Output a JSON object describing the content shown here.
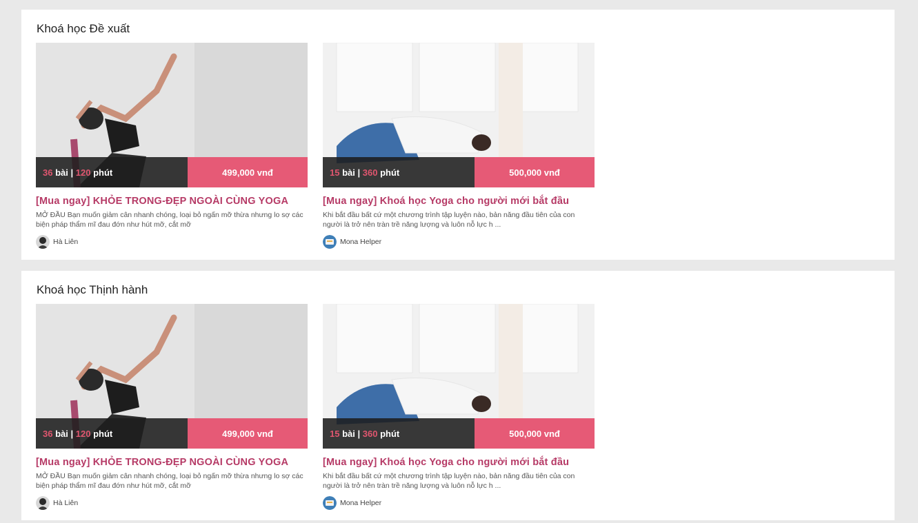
{
  "sections": [
    {
      "title": "Khoá học Đề xuất",
      "courses": [
        {
          "lessons": "36",
          "lessons_unit": "bài",
          "separator": "|",
          "minutes": "120",
          "minutes_unit": "phút",
          "price": "499,000 vnđ",
          "title": "[Mua ngay] KHỎE TRONG-ĐẸP NGOÀI CÙNG YOGA",
          "description": "MỞ ĐẦU Bạn muốn giảm cân nhanh chóng, loại bỏ ngấn mỡ thừa nhưng lo sợ các biện pháp thẩm mĩ đau đớn như hút mỡ, cắt mỡ",
          "author": "Hà Liên"
        },
        {
          "lessons": "15",
          "lessons_unit": "bài",
          "separator": "|",
          "minutes": "360",
          "minutes_unit": "phút",
          "price": "500,000 vnđ",
          "title": "[Mua ngay] Khoá học Yoga cho người mới bắt đầu",
          "description": "Khi bắt đầu bất cứ một chương trình tập luyện nào, bản năng đầu tiên của con người là trở nên tràn trề năng lượng và luôn nỗ lực h ...",
          "author": "Mona Helper"
        }
      ]
    },
    {
      "title": "Khoá học Thịnh hành",
      "courses": [
        {
          "lessons": "36",
          "lessons_unit": "bài",
          "separator": "|",
          "minutes": "120",
          "minutes_unit": "phút",
          "price": "499,000 vnđ",
          "title": "[Mua ngay] KHỎE TRONG-ĐẸP NGOÀI CÙNG YOGA",
          "description": "MỞ ĐẦU Bạn muốn giảm cân nhanh chóng, loại bỏ ngấn mỡ thừa nhưng lo sợ các biện pháp thẩm mĩ đau đớn như hút mỡ, cắt mỡ",
          "author": "Hà Liên"
        },
        {
          "lessons": "15",
          "lessons_unit": "bài",
          "separator": "|",
          "minutes": "360",
          "minutes_unit": "phút",
          "price": "500,000 vnđ",
          "title": "[Mua ngay] Khoá học Yoga cho người mới bắt đầu",
          "description": "Khi bắt đầu bất cứ một chương trình tập luyện nào, bản năng đầu tiên của con người là trở nên tràn trề năng lượng và luôn nỗ lực h ...",
          "author": "Mona Helper"
        }
      ]
    }
  ],
  "colors": {
    "page_bg": "#e9e9e9",
    "accent_title": "#b63a66",
    "price_bg": "#e65a76",
    "lesson_bg": "#1e1e1e",
    "number_accent": "#e0566f"
  },
  "icons": {
    "image_1": "yoga-pose-photo",
    "image_2": "child-pose-photo",
    "avatar_1": "author-avatar",
    "avatar_2": "mona-helper-avatar"
  }
}
